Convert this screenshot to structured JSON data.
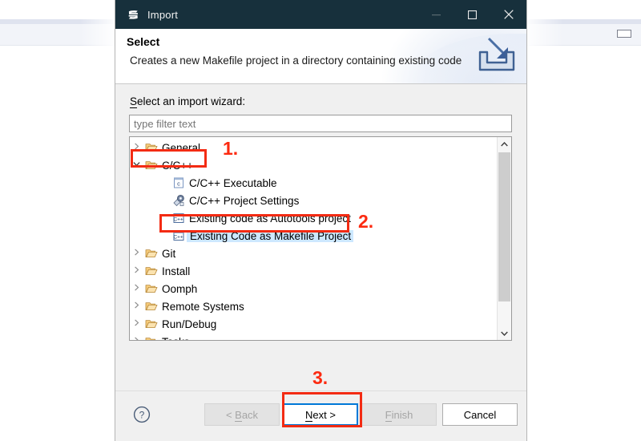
{
  "window": {
    "title": "Import",
    "app_icon": "eclipse-import-icon",
    "controls": {
      "minimize": "minimize-icon",
      "maximize": "maximize-icon",
      "close": "close-icon"
    },
    "titlebar_color": "#17303c"
  },
  "banner": {
    "heading": "Select",
    "description": "Creates a new Makefile project in a directory containing existing code",
    "icon": "import-tray-arrow-icon"
  },
  "form": {
    "tree_label": "Select an import wizard:",
    "filter_placeholder": "type filter text",
    "filter_value": ""
  },
  "tree": {
    "items": [
      {
        "label": "General",
        "icon": "folder-icon",
        "level": 0,
        "twisty": "collapsed",
        "selected": false
      },
      {
        "label": "C/C++",
        "icon": "folder-open-icon",
        "level": 0,
        "twisty": "expanded",
        "selected": false
      },
      {
        "label": "C/C++ Executable",
        "icon": "c-file-icon",
        "level": 1,
        "twisty": "none",
        "selected": false
      },
      {
        "label": "C/C++ Project Settings",
        "icon": "settings-gear-icon",
        "level": 1,
        "twisty": "none",
        "selected": false
      },
      {
        "label": "Existing code as Autotools project",
        "icon": "cpp-project-icon",
        "level": 1,
        "twisty": "none",
        "selected": false
      },
      {
        "label": "Existing Code as Makefile Project",
        "icon": "cpp-project-icon",
        "level": 1,
        "twisty": "none",
        "selected": true
      },
      {
        "label": "Git",
        "icon": "folder-icon",
        "level": 0,
        "twisty": "collapsed",
        "selected": false
      },
      {
        "label": "Install",
        "icon": "folder-icon",
        "level": 0,
        "twisty": "collapsed",
        "selected": false
      },
      {
        "label": "Oomph",
        "icon": "folder-icon",
        "level": 0,
        "twisty": "collapsed",
        "selected": false
      },
      {
        "label": "Remote Systems",
        "icon": "folder-icon",
        "level": 0,
        "twisty": "collapsed",
        "selected": false
      },
      {
        "label": "Run/Debug",
        "icon": "folder-icon",
        "level": 0,
        "twisty": "collapsed",
        "selected": false
      },
      {
        "label": "Tasks",
        "icon": "folder-icon",
        "level": 0,
        "twisty": "collapsed",
        "selected": false
      },
      {
        "label": "T",
        "icon": "folder-icon",
        "level": 0,
        "twisty": "collapsed",
        "selected": false,
        "clipped": true
      }
    ],
    "scrollbar": {
      "up_arrow": "chevron-up-icon",
      "down_arrow": "chevron-down-icon"
    }
  },
  "footer": {
    "help": "help-question-icon",
    "buttons": {
      "back": {
        "label": "< Back",
        "mnemonic": "B",
        "enabled": false,
        "default": false
      },
      "next": {
        "label": "Next >",
        "mnemonic": "N",
        "enabled": true,
        "default": true
      },
      "finish": {
        "label": "Finish",
        "mnemonic": "F",
        "enabled": false,
        "default": false
      },
      "cancel": {
        "label": "Cancel",
        "mnemonic": "",
        "enabled": true,
        "default": false
      }
    }
  },
  "annotations": {
    "color": "#fc2a10",
    "steps": [
      {
        "number": "1.",
        "target": "tree-item-c-cpp"
      },
      {
        "number": "2.",
        "target": "tree-item-existing-code-as-makefile-project"
      },
      {
        "number": "3.",
        "target": "next-button"
      }
    ]
  },
  "background": {
    "minimize_strip_icon": "restore-window-icon"
  }
}
